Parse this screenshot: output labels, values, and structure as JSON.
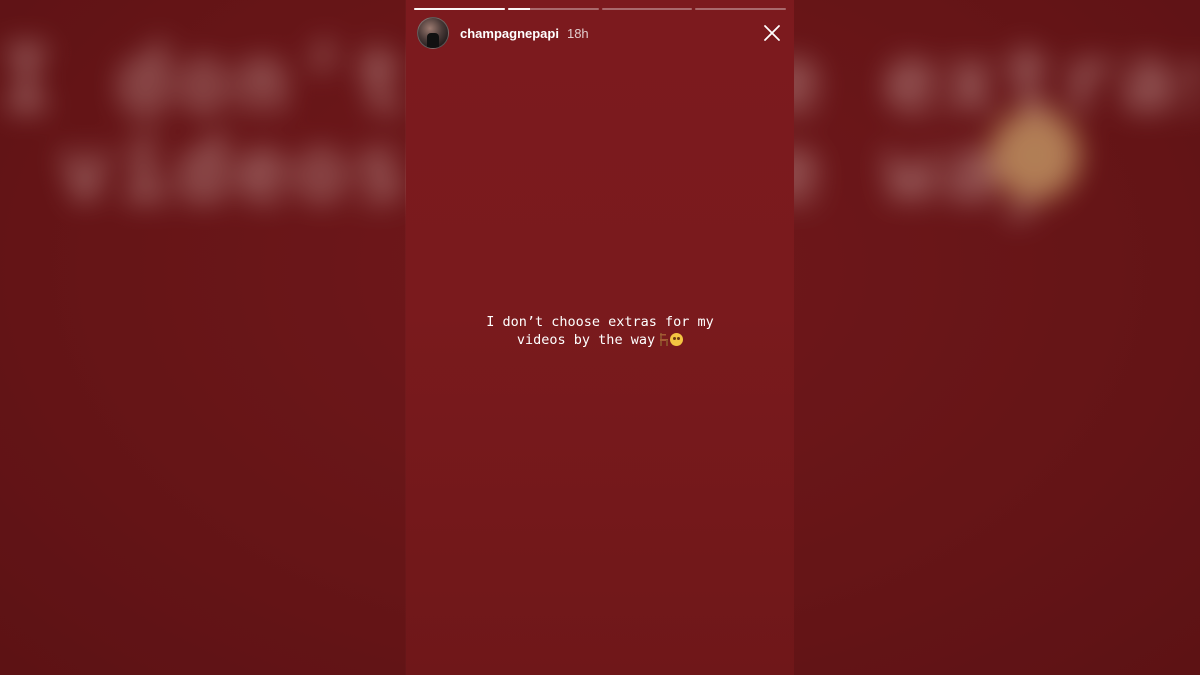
{
  "story": {
    "username": "champagnepapi",
    "time_ago": "18h",
    "progress_segments": [
      1.0,
      0.25,
      0.0,
      0.0
    ],
    "caption_lines": [
      "I don’t choose extras for my",
      "videos by the way"
    ],
    "caption_emojis": [
      "chair-icon",
      "flushed-face-icon"
    ],
    "icons": {
      "close": "close-icon",
      "avatar": "avatar"
    },
    "colors": {
      "background": "#7a1a1d",
      "text": "#ffffff"
    }
  },
  "background_blur": {
    "line1": "I don’t choose extras for my",
    "line2": "videos by the way"
  }
}
